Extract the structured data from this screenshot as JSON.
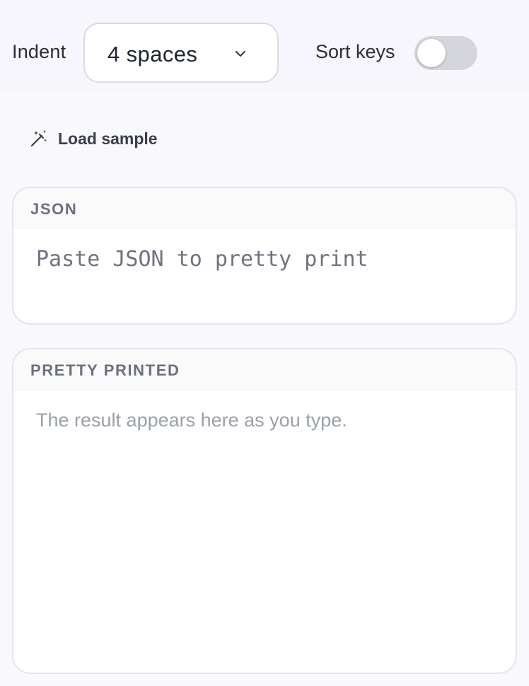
{
  "toolbar": {
    "indent_label": "Indent",
    "indent_value": "4 spaces",
    "sort_keys_label": "Sort keys",
    "sort_keys_enabled": false
  },
  "actions": {
    "load_sample_label": "Load sample"
  },
  "json_panel": {
    "header": "JSON",
    "placeholder": "Paste JSON to pretty print",
    "value": ""
  },
  "output_panel": {
    "header": "PRETTY PRINTED",
    "placeholder": "The result appears here as you type."
  },
  "colors": {
    "background": "#f8f8fd",
    "panel_border": "#e4e5ea",
    "toggle_off": "#d4d6dc",
    "muted_text": "#9aa0ab"
  },
  "icons": {
    "indent_select": "chevron-down-icon",
    "load_sample": "magic-wand-icon"
  }
}
